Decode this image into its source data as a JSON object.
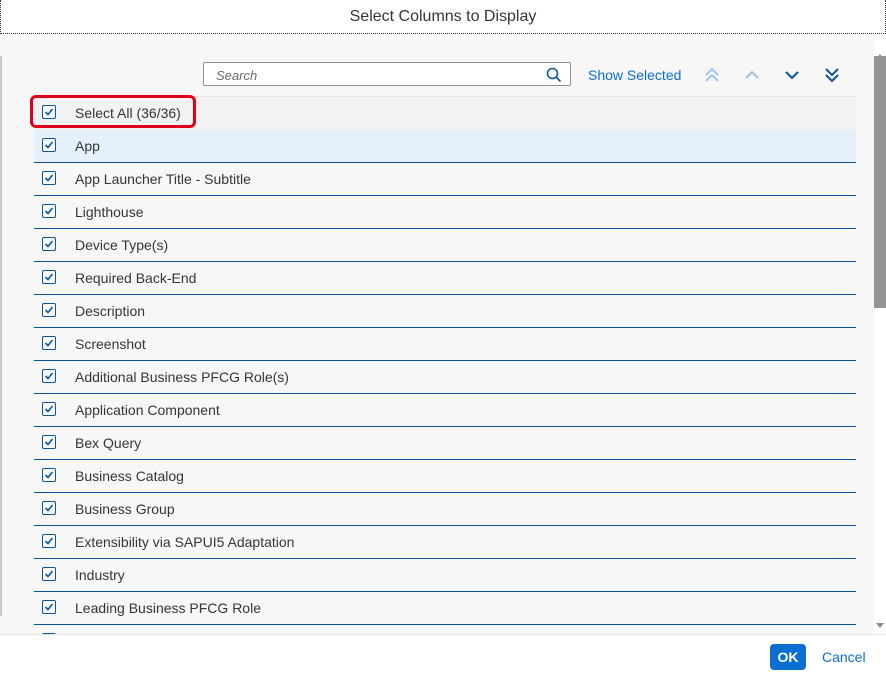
{
  "dialog": {
    "title": "Select Columns to Display"
  },
  "toolbar": {
    "search_placeholder": "Search",
    "search_value": "",
    "show_selected_label": "Show Selected",
    "icons": {
      "search": "search-icon",
      "move_top": "double-chevron-up-icon",
      "move_up": "chevron-up-icon",
      "move_down": "chevron-down-icon",
      "move_bottom": "double-chevron-down-icon"
    }
  },
  "select_all": {
    "label": "Select All (36/36)",
    "checked": true
  },
  "columns": [
    {
      "label": "App",
      "checked": true
    },
    {
      "label": "App Launcher Title - Subtitle",
      "checked": true
    },
    {
      "label": "Lighthouse",
      "checked": true
    },
    {
      "label": "Device Type(s)",
      "checked": true
    },
    {
      "label": "Required Back-End",
      "checked": true
    },
    {
      "label": "Description",
      "checked": true
    },
    {
      "label": "Screenshot",
      "checked": true
    },
    {
      "label": "Additional Business PFCG Role(s)",
      "checked": true
    },
    {
      "label": "Application Component",
      "checked": true
    },
    {
      "label": "Bex Query",
      "checked": true
    },
    {
      "label": "Business Catalog",
      "checked": true
    },
    {
      "label": "Business Group",
      "checked": true
    },
    {
      "label": "Extensibility via SAPUI5 Adaptation",
      "checked": true
    },
    {
      "label": "Industry",
      "checked": true
    },
    {
      "label": "Leading Business PFCG Role",
      "checked": true
    },
    {
      "label": "",
      "checked": true
    }
  ],
  "footer": {
    "ok_label": "OK",
    "cancel_label": "Cancel"
  },
  "colors": {
    "accent": "#0a6ed1",
    "row_border": "#0854a0",
    "highlight_row": "#e5f0fa",
    "annotation_box": "#e0001a"
  }
}
